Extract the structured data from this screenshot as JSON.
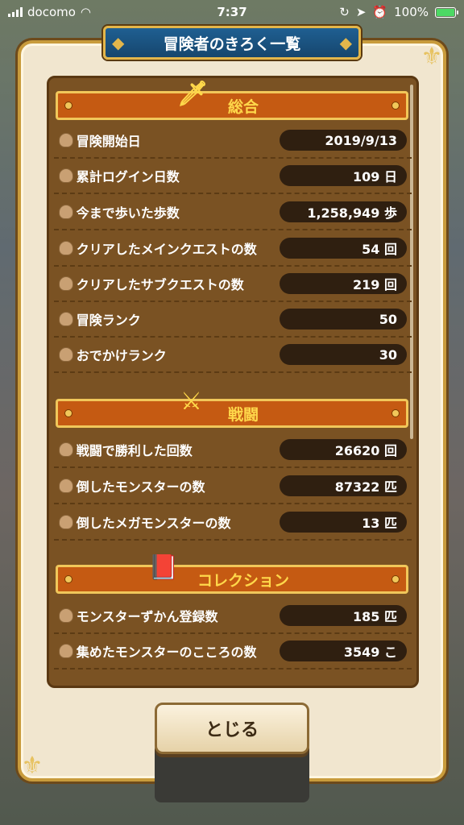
{
  "status_bar": {
    "carrier": "docomo",
    "time": "7:37",
    "battery": "100%"
  },
  "dialog": {
    "title": "冒険者のきろく一覧",
    "close_label": "とじる"
  },
  "sections": [
    {
      "title": "総合",
      "icon": "winged-sword-icon",
      "rows": [
        {
          "label": "冒険開始日",
          "value": "2019/9/13"
        },
        {
          "label": "累計ログイン日数",
          "value": "109 日"
        },
        {
          "label": "今まで歩いた歩数",
          "value": "1,258,949 歩"
        },
        {
          "label": "クリアしたメインクエストの数",
          "value": "54 回"
        },
        {
          "label": "クリアしたサブクエストの数",
          "value": "219 回"
        },
        {
          "label": "冒険ランク",
          "value": "50"
        },
        {
          "label": "おでかけランク",
          "value": "30"
        }
      ]
    },
    {
      "title": "戦闘",
      "icon": "crossed-swords-icon",
      "rows": [
        {
          "label": "戦闘で勝利した回数",
          "value": "26620 回"
        },
        {
          "label": "倒したモンスターの数",
          "value": "87322 匹"
        },
        {
          "label": "倒したメガモンスターの数",
          "value": "13 匹"
        }
      ]
    },
    {
      "title": "コレクション",
      "icon": "red-book-icon",
      "rows": [
        {
          "label": "モンスターずかん登録数",
          "value": "185 匹"
        },
        {
          "label": "集めたモンスターのこころの数",
          "value": "3549 こ"
        }
      ]
    }
  ],
  "colors": {
    "panel": "#7a5223",
    "section_header": "#c55a12",
    "section_text": "#ffd84a",
    "title_banner": "#1f5f92",
    "frame_gold": "#c89b3c"
  }
}
